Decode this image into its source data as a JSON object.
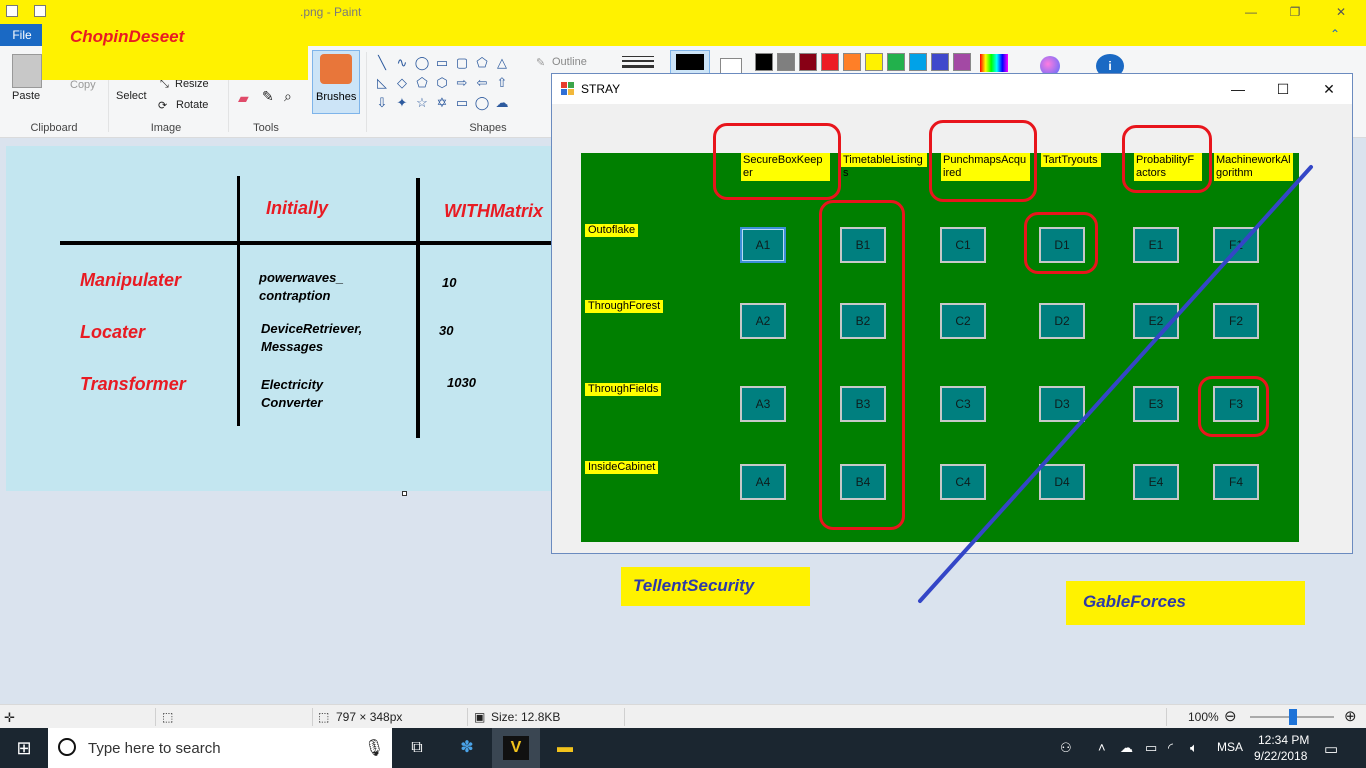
{
  "paint": {
    "title": ".png - Paint",
    "file_tab": "File",
    "ribbon": {
      "paste": "Paste",
      "copy": "Copy",
      "select": "Select",
      "resize": "Resize",
      "rotate": "Rotate",
      "brushes": "Brushes",
      "outline": "Outline",
      "groups": [
        "Clipboard",
        "Image",
        "Tools",
        "Shapes"
      ]
    },
    "colors": [
      "#000000",
      "#7f7f7f",
      "#880015",
      "#ed1c24",
      "#ff7f27",
      "#fff200",
      "#22b14c",
      "#00a2e8",
      "#3f48cc",
      "#a349a4"
    ],
    "status": {
      "dimensions": "797 × 348px",
      "size": "Size: 12.8KB",
      "zoom": "100%"
    }
  },
  "overlay_label": "ChopinDeseet",
  "canvas": {
    "headers": [
      "Initially",
      "WITHMatrix"
    ],
    "rows": [
      {
        "label": "Manipulater",
        "item": "powerwaves_\ncontraption",
        "value": "10"
      },
      {
        "label": "Locater",
        "item": "DeviceRetriever,\nMessages",
        "value": "30"
      },
      {
        "label": "Transformer",
        "item": "Electricity\nConverter",
        "value": "1030"
      }
    ]
  },
  "stray": {
    "title": "STRAY",
    "columns": [
      "SecureBoxKeeper",
      "TimetableListings",
      "PunchmapsAcquired",
      "TartTryouts",
      "ProbabilityFactors",
      "MachineworkAlgorithm"
    ],
    "rows": [
      "Outoflake",
      "ThroughForest",
      "ThroughFields",
      "InsideCabinet"
    ],
    "cells": [
      [
        "A1",
        "B1",
        "C1",
        "D1",
        "E1",
        "F1"
      ],
      [
        "A2",
        "B2",
        "C2",
        "D2",
        "E2",
        "F2"
      ],
      [
        "A3",
        "B3",
        "C3",
        "D3",
        "E3",
        "F3"
      ],
      [
        "A4",
        "B4",
        "C4",
        "D4",
        "E4",
        "F4"
      ]
    ]
  },
  "labels": {
    "tellent": "TellentSecurity",
    "gable": "GableForces"
  },
  "taskbar": {
    "search_placeholder": "Type here to search",
    "language": "MSA",
    "time": "12:34 PM",
    "date": "9/22/2018"
  }
}
